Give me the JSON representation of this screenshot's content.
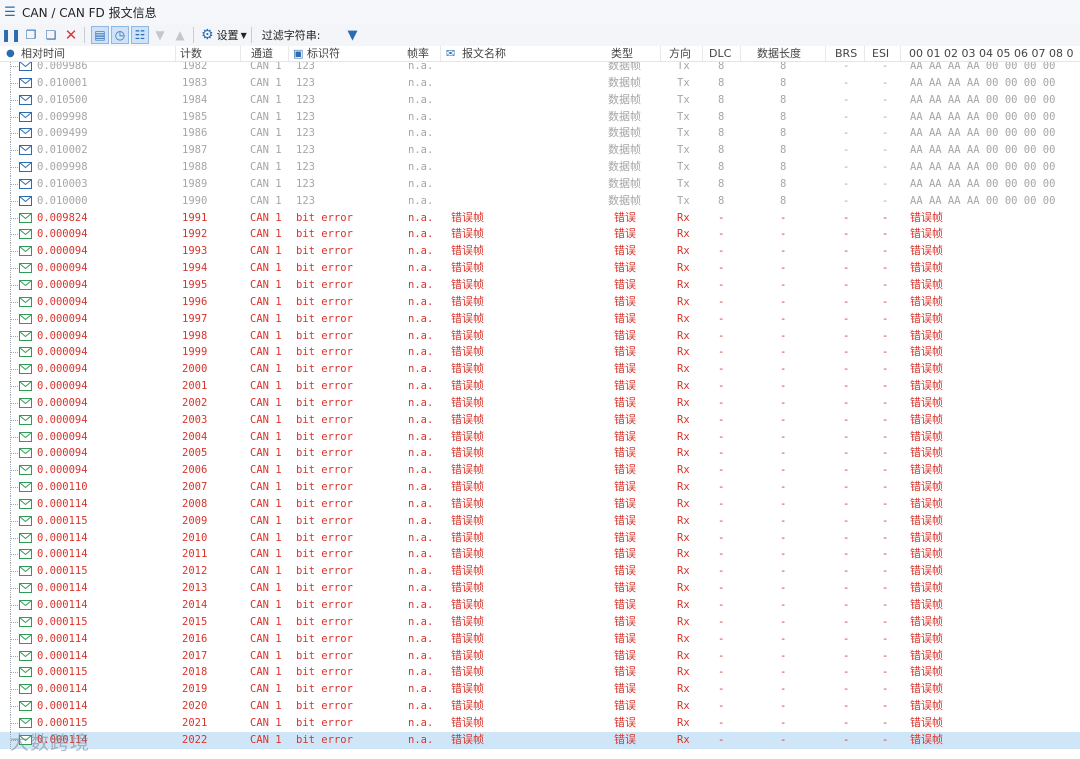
{
  "window": {
    "title": "CAN / CAN FD 报文信息"
  },
  "toolbar": {
    "settings_label": "设置",
    "filter_label": "过滤字符串:",
    "filter_value": ""
  },
  "columns": {
    "time": "相对时间",
    "count": "计数",
    "channel": "通道",
    "id": "标识符",
    "rate": "帧率",
    "name": "报文名称",
    "type": "类型",
    "dir": "方向",
    "dlc": "DLC",
    "len": "数据长度",
    "brs": "BRS",
    "esi": "ESI",
    "data": "00 01 02 03 04 05 06 07 08 0"
  },
  "tx_rows": [
    {
      "time": "0.009986",
      "count": "1982"
    },
    {
      "time": "0.010001",
      "count": "1983"
    },
    {
      "time": "0.010500",
      "count": "1984"
    },
    {
      "time": "0.009998",
      "count": "1985"
    },
    {
      "time": "0.009499",
      "count": "1986"
    },
    {
      "time": "0.010002",
      "count": "1987"
    },
    {
      "time": "0.009998",
      "count": "1988"
    },
    {
      "time": "0.010003",
      "count": "1989"
    },
    {
      "time": "0.010000",
      "count": "1990"
    }
  ],
  "tx_common": {
    "channel": "CAN 1",
    "id": "123",
    "rate": "n.a.",
    "name": "",
    "type": "数据帧",
    "dir": "Tx",
    "dlc": "8",
    "len": "8",
    "brs": "-",
    "esi": "-",
    "data": "AA AA AA AA 00 00 00 00"
  },
  "err_rows": [
    {
      "time": "0.009824",
      "count": "1991"
    },
    {
      "time": "0.000094",
      "count": "1992"
    },
    {
      "time": "0.000094",
      "count": "1993"
    },
    {
      "time": "0.000094",
      "count": "1994"
    },
    {
      "time": "0.000094",
      "count": "1995"
    },
    {
      "time": "0.000094",
      "count": "1996"
    },
    {
      "time": "0.000094",
      "count": "1997"
    },
    {
      "time": "0.000094",
      "count": "1998"
    },
    {
      "time": "0.000094",
      "count": "1999"
    },
    {
      "time": "0.000094",
      "count": "2000"
    },
    {
      "time": "0.000094",
      "count": "2001"
    },
    {
      "time": "0.000094",
      "count": "2002"
    },
    {
      "time": "0.000094",
      "count": "2003"
    },
    {
      "time": "0.000094",
      "count": "2004"
    },
    {
      "time": "0.000094",
      "count": "2005"
    },
    {
      "time": "0.000094",
      "count": "2006"
    },
    {
      "time": "0.000110",
      "count": "2007"
    },
    {
      "time": "0.000114",
      "count": "2008"
    },
    {
      "time": "0.000115",
      "count": "2009"
    },
    {
      "time": "0.000114",
      "count": "2010"
    },
    {
      "time": "0.000114",
      "count": "2011"
    },
    {
      "time": "0.000115",
      "count": "2012"
    },
    {
      "time": "0.000114",
      "count": "2013"
    },
    {
      "time": "0.000114",
      "count": "2014"
    },
    {
      "time": "0.000115",
      "count": "2015"
    },
    {
      "time": "0.000114",
      "count": "2016"
    },
    {
      "time": "0.000114",
      "count": "2017"
    },
    {
      "time": "0.000115",
      "count": "2018"
    },
    {
      "time": "0.000114",
      "count": "2019"
    },
    {
      "time": "0.000114",
      "count": "2020"
    },
    {
      "time": "0.000115",
      "count": "2021"
    },
    {
      "time": "0.000114",
      "count": "2022"
    }
  ],
  "err_common": {
    "channel": "CAN 1",
    "id": "bit error",
    "rate": "n.a.",
    "name": "错误帧",
    "type": "错误",
    "dir": "Rx",
    "dlc": "-",
    "len": "-",
    "brs": "-",
    "esi": "-",
    "data": "错误帧"
  },
  "selected_count": "2022",
  "watermark": "大数跨境",
  "colors": {
    "error_text": "#d9342b",
    "tx_text": "#a6a6a6",
    "selection": "#cfe6f9",
    "accent": "#2b6cb0"
  },
  "icons": [
    "menu-icon",
    "pause-icon",
    "copy-icon",
    "copy-all-icon",
    "clear-icon",
    "window-icon",
    "clock-icon",
    "sort-icon",
    "scroll-down-icon",
    "scroll-up-icon",
    "gear-icon",
    "filter-icon",
    "envelope-icon"
  ]
}
